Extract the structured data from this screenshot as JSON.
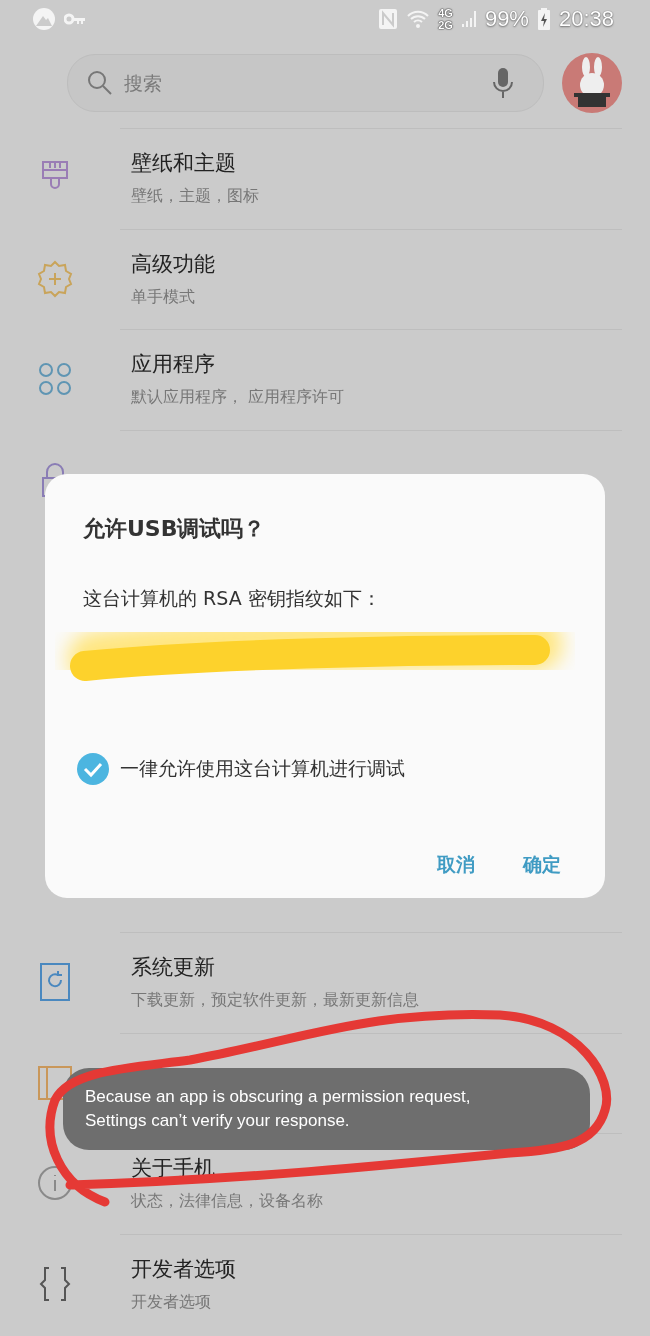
{
  "status_bar": {
    "network_top": "4G",
    "network_bottom": "2G",
    "battery": "99%",
    "time": "20:38"
  },
  "search": {
    "placeholder": "搜索"
  },
  "upper_items": [
    {
      "kind": "brush",
      "title": "壁纸和主题",
      "subtitle": "壁纸，主题，图标"
    },
    {
      "kind": "gear",
      "title": "高级功能",
      "subtitle": "单手模式"
    },
    {
      "kind": "apps",
      "title": "应用程序",
      "subtitle": "默认应用程序， 应用程序许可"
    },
    {
      "kind": "lock"
    }
  ],
  "lower_items": [
    {
      "kind": "update",
      "title": "系统更新",
      "subtitle": "下载更新，预定软件更新，最新更新信息"
    },
    {
      "kind": "book"
    },
    {
      "kind": "info",
      "title": "关于手机",
      "subtitle": "状态，法律信息，设备名称"
    },
    {
      "kind": "braces",
      "title": "开发者选项",
      "subtitle": "开发者选项"
    }
  ],
  "dialog": {
    "title": "允许USB调试吗？",
    "message": "这台计算机的 RSA 密钥指纹如下：",
    "redacted": true,
    "checkbox": {
      "label": "一律允许使用这台计算机进行调试",
      "checked": true
    },
    "buttons": [
      "取消",
      "确定"
    ]
  },
  "toast": {
    "text": "Because an app is obscuring a permission request,\nSettings can’t verify your response."
  },
  "annotation": {
    "kind": "circle"
  }
}
